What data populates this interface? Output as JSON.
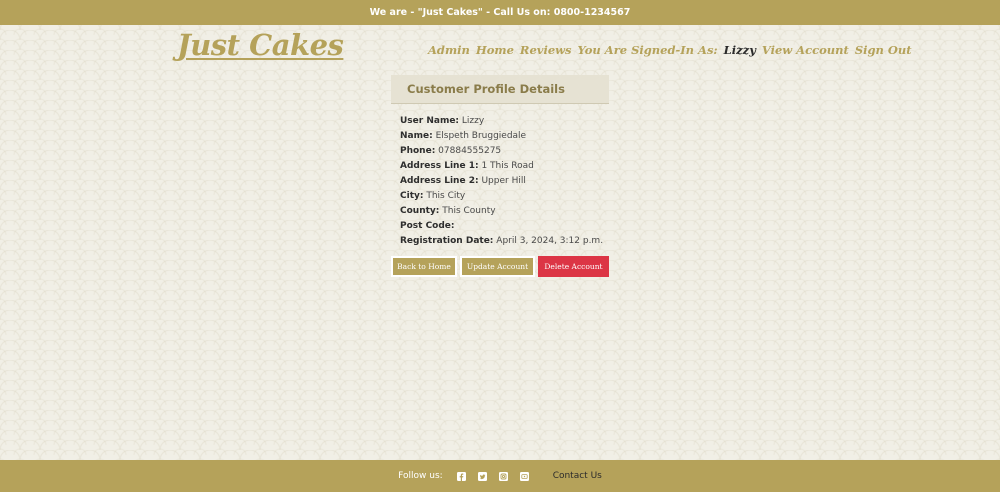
{
  "topbar": {
    "text": "We are - \"Just Cakes\" - Call Us on: 0800-1234567"
  },
  "brand": {
    "logo": "Just Cakes"
  },
  "nav": {
    "admin": "Admin",
    "home": "Home",
    "reviews": "Reviews",
    "signed_in_as": "You Are Signed-In As:",
    "username": "Lizzy",
    "view_account": "View Account",
    "sign_out": "Sign Out"
  },
  "profile": {
    "heading": "Customer Profile Details",
    "fields": [
      {
        "label": "User Name:",
        "value": "Lizzy"
      },
      {
        "label": "Name:",
        "value": "Elspeth Bruggiedale"
      },
      {
        "label": "Phone:",
        "value": "07884555275"
      },
      {
        "label": "Address Line 1:",
        "value": "1 This Road"
      },
      {
        "label": "Address Line 2:",
        "value": "Upper Hill"
      },
      {
        "label": "City:",
        "value": "This City"
      },
      {
        "label": "County:",
        "value": "This County"
      },
      {
        "label": "Post Code:",
        "value": ""
      },
      {
        "label": "Registration Date:",
        "value": "April 3, 2024, 3:12 p.m."
      }
    ]
  },
  "actions": {
    "back_home": "Back to Home",
    "update": "Update Account",
    "delete": "Delete Account"
  },
  "footer": {
    "follow": "Follow us:",
    "icons": [
      "facebook-icon",
      "twitter-icon",
      "instagram-icon",
      "youtube-icon"
    ],
    "contact": "Contact Us"
  },
  "colors": {
    "brand": "#b5a25a",
    "danger": "#dc3545",
    "background": "#f1efe6"
  }
}
